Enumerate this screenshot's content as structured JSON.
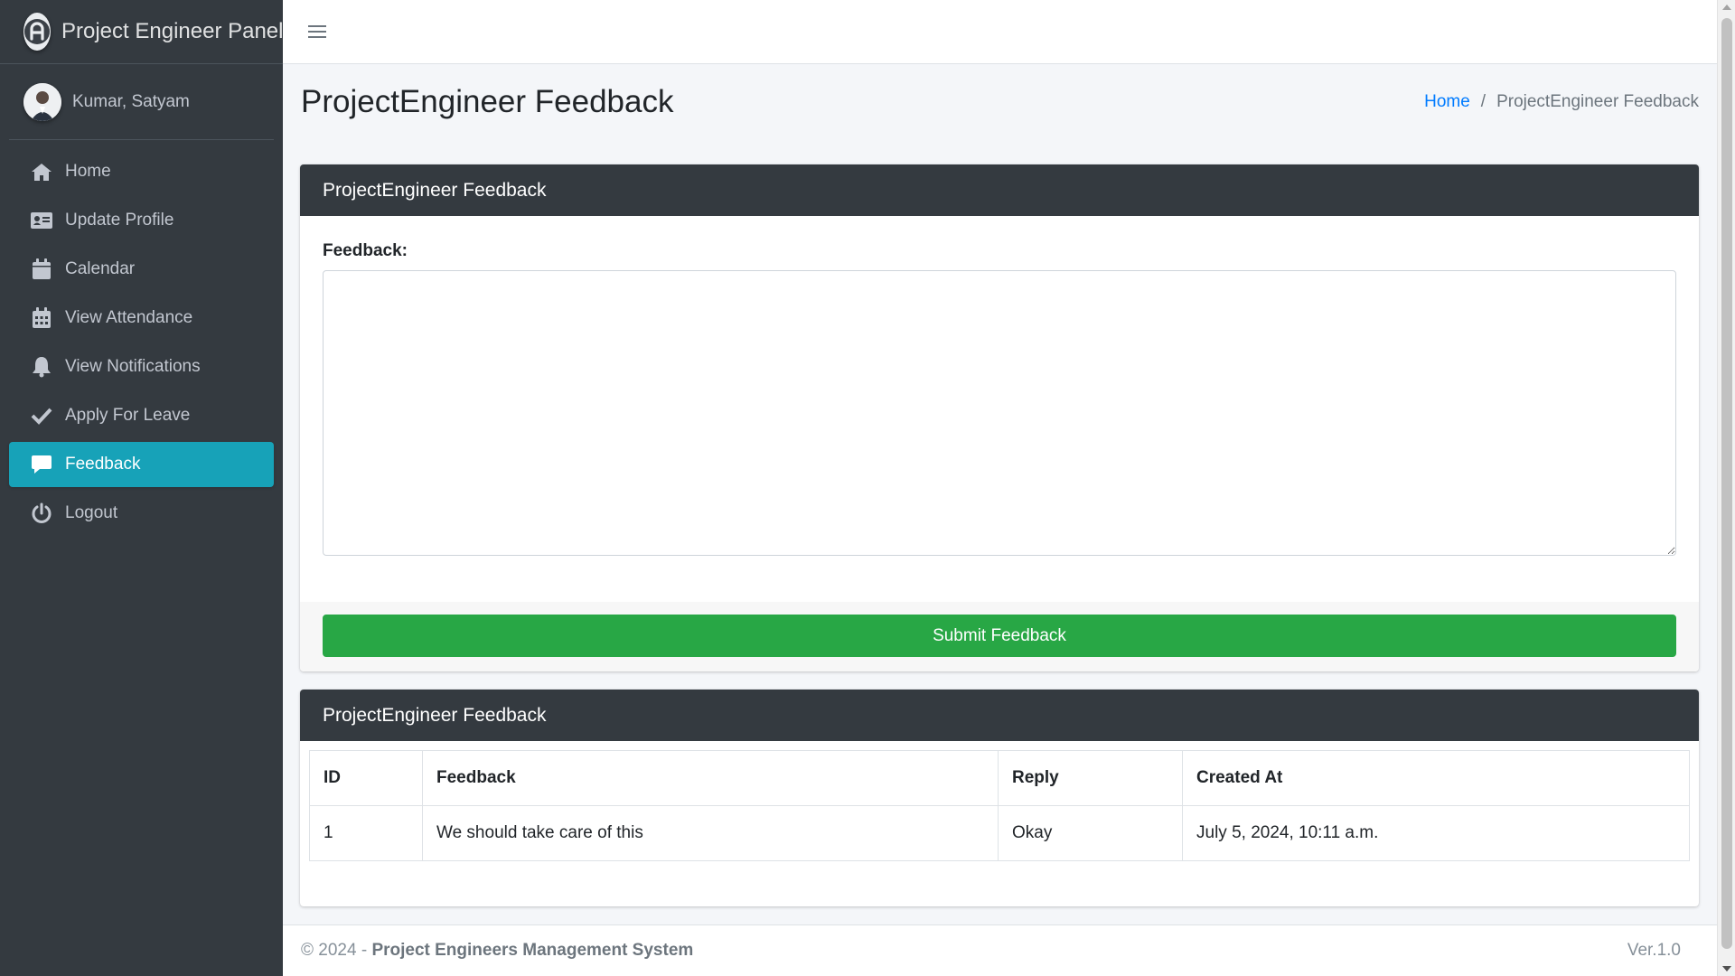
{
  "brand": {
    "title": "Project Engineer Panel"
  },
  "user": {
    "name": "Kumar, Satyam"
  },
  "sidebar": {
    "items": [
      {
        "label": "Home",
        "icon": "home-icon"
      },
      {
        "label": "Update Profile",
        "icon": "id-card-icon"
      },
      {
        "label": "Calendar",
        "icon": "calendar-icon"
      },
      {
        "label": "View Attendance",
        "icon": "calendar-grid-icon"
      },
      {
        "label": "View Notifications",
        "icon": "bell-icon"
      },
      {
        "label": "Apply For Leave",
        "icon": "check-icon"
      },
      {
        "label": "Feedback",
        "icon": "comment-icon",
        "active": true
      },
      {
        "label": "Logout",
        "icon": "power-icon"
      }
    ]
  },
  "header": {
    "title": "ProjectEngineer Feedback",
    "breadcrumb": {
      "home": "Home",
      "separator": "/",
      "current": "ProjectEngineer Feedback"
    }
  },
  "feedback_form": {
    "card_title": "ProjectEngineer Feedback",
    "label": "Feedback:",
    "textarea_value": "",
    "submit_label": "Submit Feedback"
  },
  "feedback_table": {
    "card_title": "ProjectEngineer Feedback",
    "columns": [
      "ID",
      "Feedback",
      "Reply",
      "Created At"
    ],
    "rows": [
      {
        "id": "1",
        "feedback": "We should take care of this",
        "reply": "Okay",
        "created_at": "July 5, 2024, 10:11 a.m."
      }
    ]
  },
  "footer": {
    "copyright_prefix": "© 2024 - ",
    "system_name": "Project Engineers Management System",
    "version": "Ver.1.0"
  },
  "colors": {
    "sidebar_bg": "#343a40",
    "active_item": "#17a2b8",
    "submit_green": "#28a745",
    "link_blue": "#007bff"
  }
}
